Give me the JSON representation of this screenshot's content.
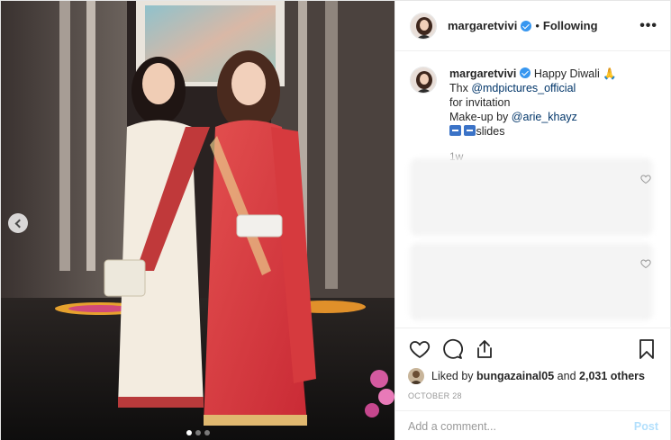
{
  "post": {
    "image_alt": "Two women in saris, one cream and one red, at a Diwali event",
    "carousel": {
      "slides": 3,
      "active": 1
    }
  },
  "header": {
    "username": "margaretvivi",
    "separator": "•",
    "follow_status": "Following",
    "more_icon": "more-horizontal-icon",
    "more_label": "•••"
  },
  "caption": {
    "username": "margaretvivi",
    "text_1": "Happy Diwali",
    "emoji_1": "🙏",
    "thx": "Thx",
    "mention_1": "@mdpictures_official",
    "line_2": "for invitation",
    "makeup": "Make-up by",
    "mention_2": "@arie_khayz",
    "slides_label": "slides",
    "time": "1w"
  },
  "actions": {
    "like_icon": "heart-icon",
    "comment_icon": "comment-icon",
    "share_icon": "share-icon",
    "save_icon": "bookmark-icon"
  },
  "likes": {
    "prefix": "Liked by",
    "user": "bungazainal05",
    "and": "and",
    "count": "2,031 others"
  },
  "date": "OCTOBER 28",
  "comment_box": {
    "placeholder": "Add a comment...",
    "post_label": "Post"
  },
  "colors": {
    "verified": "#3897f0",
    "link": "#003569",
    "post_disabled": "#b2dffc",
    "muted": "#999999"
  }
}
